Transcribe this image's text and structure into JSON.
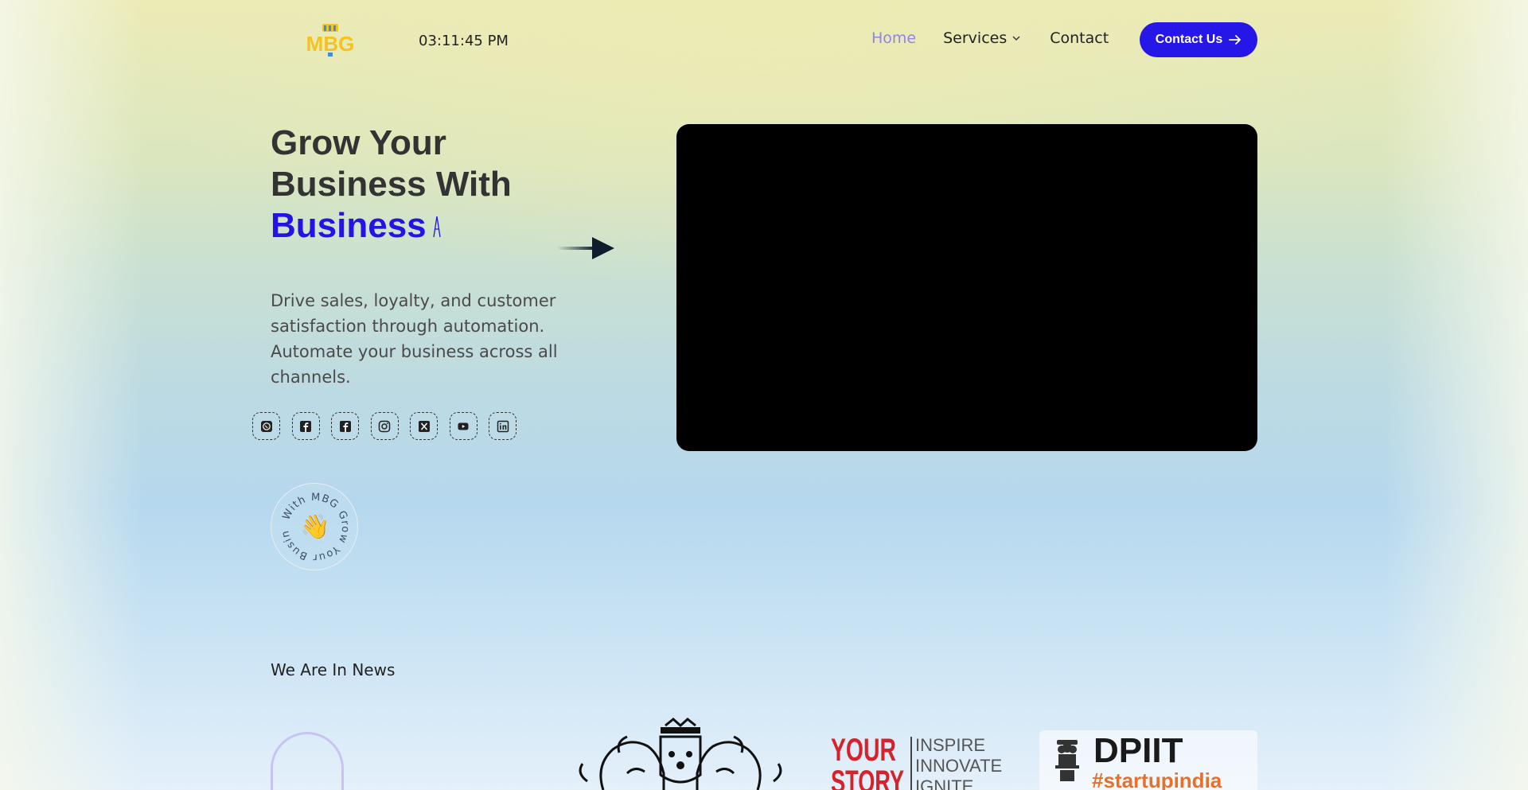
{
  "nav": {
    "logo_text": "MBG",
    "clock": "03:11:45 PM",
    "links": [
      {
        "label": "Home",
        "active": true
      },
      {
        "label": "Services"
      },
      {
        "label": "Contact"
      }
    ],
    "cta_label": "Contact Us"
  },
  "hero": {
    "title_line1": "Grow Your",
    "title_line2": "Business With",
    "title_accent": "Business",
    "description": "Drive sales, loyalty, and customer satisfaction through automation. Automate your business across all channels.",
    "socials": [
      "whatsapp-icon",
      "facebook-icon",
      "facebook-icon",
      "instagram-icon",
      "x-icon",
      "youtube-icon",
      "linkedin-icon"
    ],
    "badge_text": "With MBG Grow Your Business",
    "badge_emoji": "👋"
  },
  "news": {
    "title": "We Are In News",
    "yourstory": {
      "brand_line1": "YOUR",
      "brand_line2": "STORY",
      "tag1": "INSPIRE",
      "tag2": "INNOVATE",
      "tag3": "IGNITE"
    },
    "dpiit": {
      "title": "DPIIT",
      "hashtag": "#startupindia"
    }
  },
  "colors": {
    "accent": "#2512e6",
    "cta": "#2716e8",
    "nav_active": "#8f86e6",
    "logo_yellow": "#f6c21c",
    "logo_blue": "#3a8ee6"
  }
}
